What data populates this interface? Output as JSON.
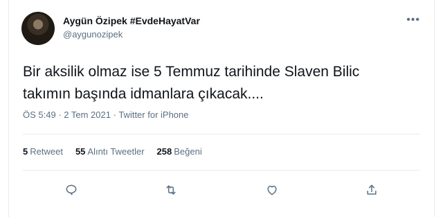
{
  "user": {
    "display_name": "Aygün Özipek #EvdeHayatVar",
    "handle": "@aygunozipek"
  },
  "more_icon": "more-horizontal-icon",
  "tweet": {
    "line1": "Bir aksilik olmaz ise 5 Temmuz tarihinde Slaven Bilic",
    "line2": "takımın başında idmanlara çıkacak...."
  },
  "meta": {
    "time": "ÖS 5:49",
    "date": "2 Tem 2021",
    "source": "Twitter for iPhone"
  },
  "stats": {
    "retweets_count": "5",
    "retweets_label": "Retweet",
    "quotes_count": "55",
    "quotes_label": "Alıntı Tweetler",
    "likes_count": "258",
    "likes_label": "Beğeni"
  },
  "actions": [
    {
      "icon": "reply-icon"
    },
    {
      "icon": "retweet-icon"
    },
    {
      "icon": "like-icon"
    },
    {
      "icon": "share-icon"
    }
  ],
  "colors": {
    "text": "#0f1419",
    "secondary": "#5b7083",
    "border": "#e6ecf0"
  }
}
